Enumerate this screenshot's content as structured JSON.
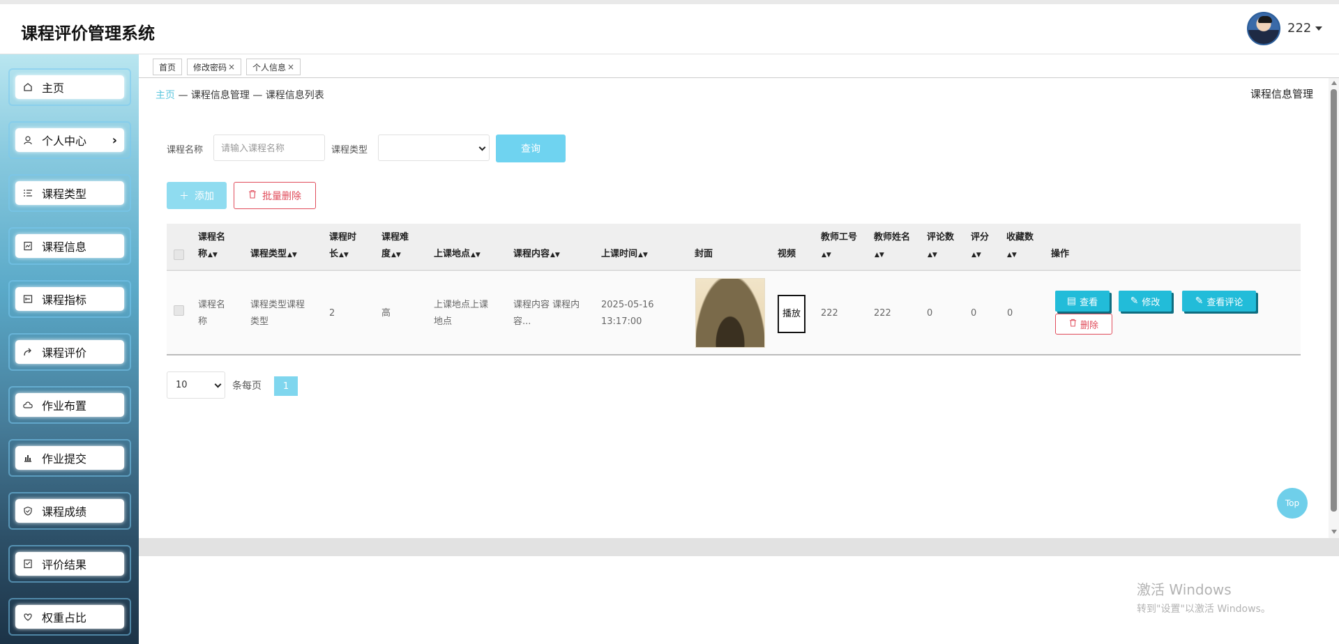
{
  "app": {
    "title": "课程评价管理系统",
    "user": "222"
  },
  "sidebar": {
    "items": [
      {
        "label": "主页",
        "icon": "home-icon"
      },
      {
        "label": "个人中心",
        "icon": "user-icon",
        "has_arrow": true
      },
      {
        "label": "课程类型",
        "icon": "list-icon"
      },
      {
        "label": "课程信息",
        "icon": "document-icon"
      },
      {
        "label": "课程指标",
        "icon": "target-icon"
      },
      {
        "label": "课程评价",
        "icon": "share-icon"
      },
      {
        "label": "作业布置",
        "icon": "cloud-icon"
      },
      {
        "label": "作业提交",
        "icon": "bar-chart-icon"
      },
      {
        "label": "课程成绩",
        "icon": "shield-icon"
      },
      {
        "label": "评价结果",
        "icon": "checklist-icon"
      },
      {
        "label": "权重占比",
        "icon": "heart-icon"
      }
    ]
  },
  "tabs": [
    {
      "label": "首页",
      "closable": false
    },
    {
      "label": "修改密码",
      "closable": true
    },
    {
      "label": "个人信息",
      "closable": true
    }
  ],
  "breadcrumb": {
    "home": "主页",
    "sep1": " — ",
    "level1": "课程信息管理",
    "sep2": " — ",
    "level2": "课程信息列表"
  },
  "page_title": "课程信息管理",
  "search": {
    "name_label": "课程名称",
    "name_placeholder": "请输入课程名称",
    "type_label": "课程类型",
    "type_value": "",
    "query_label": "查询"
  },
  "actions": {
    "add_label": "添加",
    "batch_delete_label": "批量删除"
  },
  "table": {
    "headers": {
      "name_line1": "课程名",
      "name_line2": "称",
      "type": "课程类型",
      "duration_line1": "课程时",
      "duration_line2": "长",
      "difficulty_line1": "课程难",
      "difficulty_line2": "度",
      "location": "上课地点",
      "content": "课程内容",
      "time": "上课时间",
      "cover": "封面",
      "video": "视频",
      "teacher_id": "教师工号",
      "teacher_name": "教师姓名",
      "comments": "评论数",
      "score": "评分",
      "favorites": "收藏数",
      "operations": "操作"
    },
    "rows": [
      {
        "name_line1": "课程名",
        "name_line2": "称",
        "type_line1": "课程类型课程",
        "type_line2": "类型",
        "duration": "2",
        "difficulty": "高",
        "location_line1": "上课地点上课",
        "location_line2": "地点",
        "content_line1": "课程内容 课程内",
        "content_line2": "容...",
        "time_line1": "2025-05-16",
        "time_line2": "13:17:00",
        "video_line1": "播",
        "video_line2": "放",
        "teacher_id": "222",
        "teacher_name": "222",
        "comments": "0",
        "score": "0",
        "favorites": "0",
        "ops": {
          "view": "查看",
          "edit": "修改",
          "comments": "查看评论",
          "delete": "删除"
        }
      }
    ]
  },
  "pagination": {
    "page_size": "10",
    "per_page_label": "条每页",
    "current_page": "1"
  },
  "back_to_top": "Top",
  "watermark": {
    "title": "激活 Windows",
    "subtitle": "转到\"设置\"以激活 Windows。"
  }
}
